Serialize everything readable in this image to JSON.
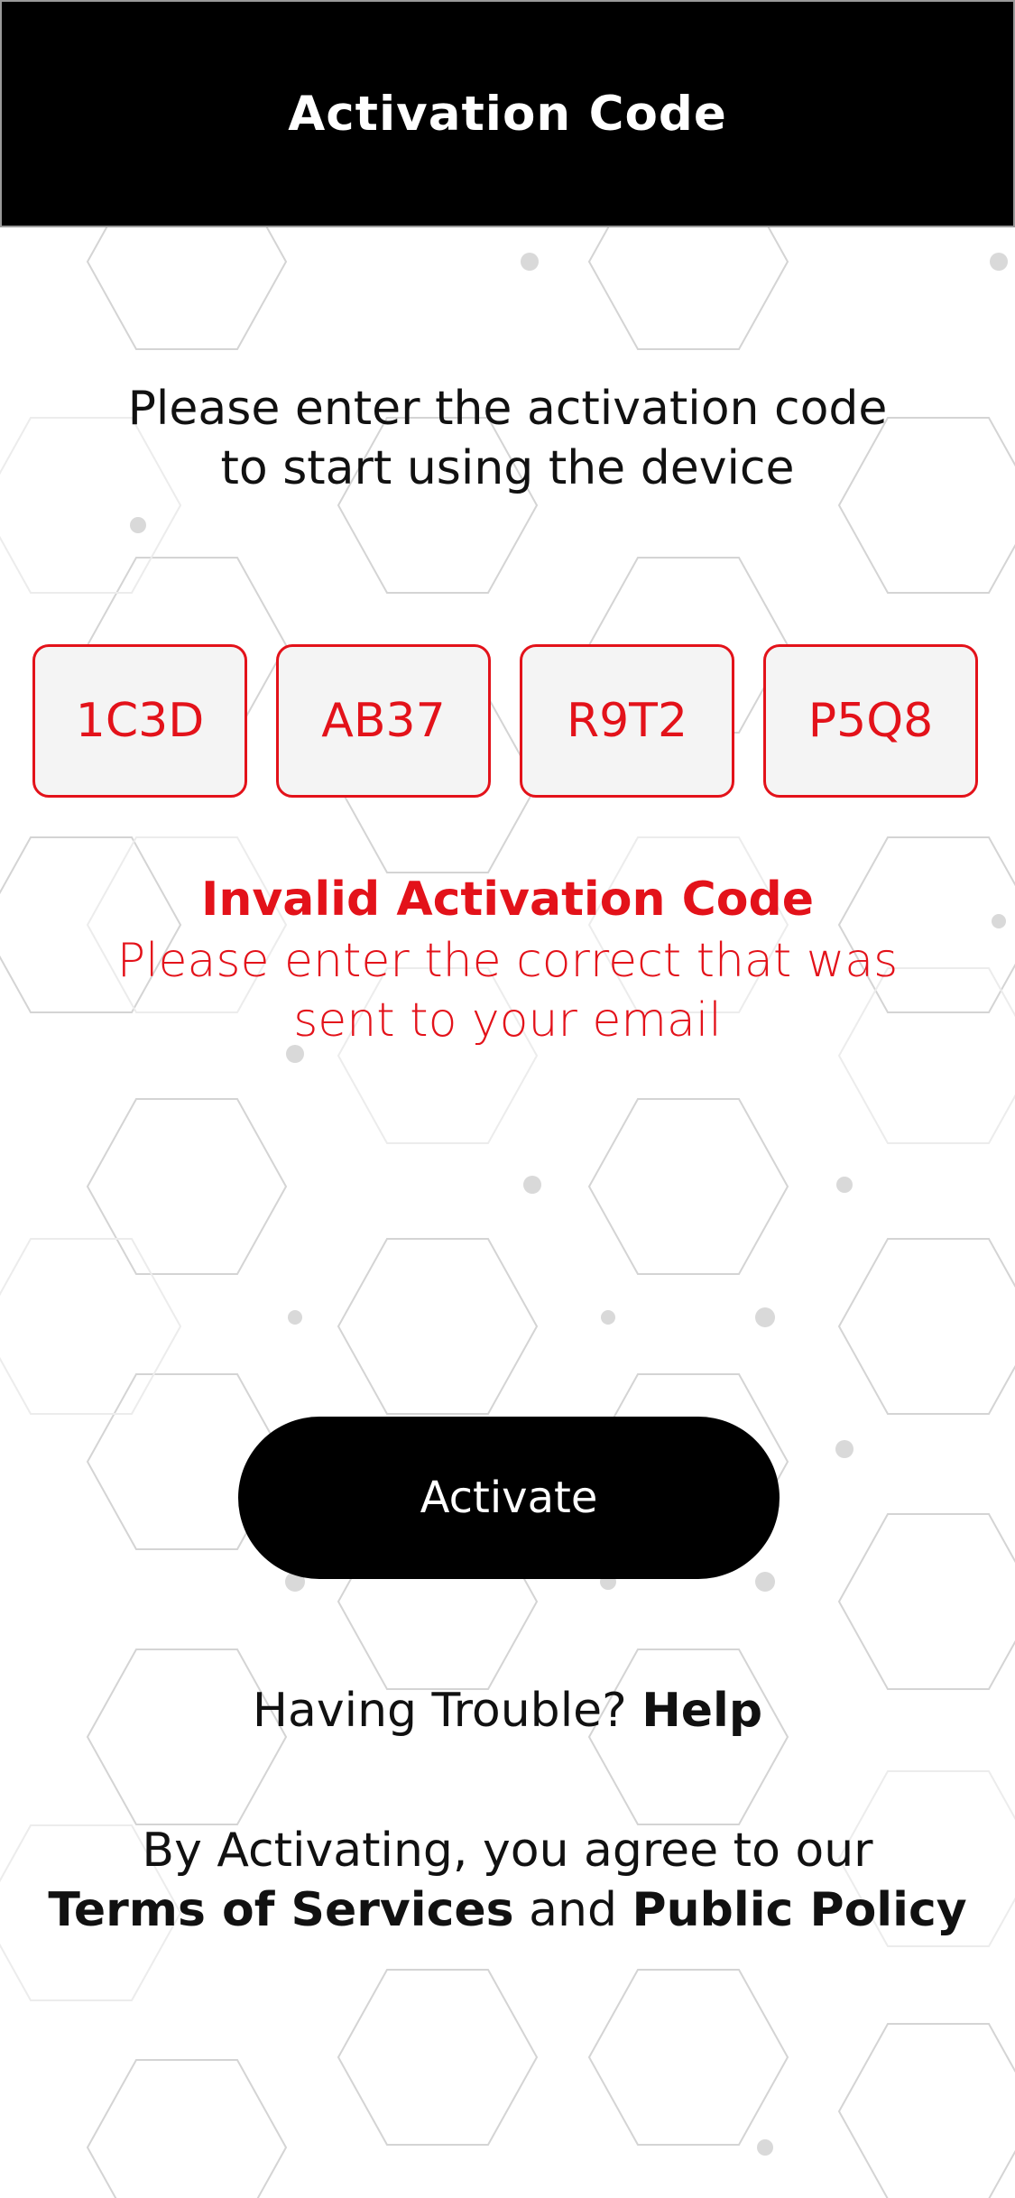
{
  "header": {
    "title": "Activation Code"
  },
  "instructions": {
    "line1": "Please enter the activation code",
    "line2": "to start using the device"
  },
  "code_fields": [
    {
      "value": "1C3D"
    },
    {
      "value": "AB37"
    },
    {
      "value": "R9T2"
    },
    {
      "value": "P5Q8"
    }
  ],
  "error": {
    "title": "Invalid Activation Code",
    "line1": "Please enter the correct that was",
    "line2": "sent to your email"
  },
  "activate_button": {
    "label": "Activate"
  },
  "help": {
    "prefix": "Having Trouble?",
    "link": "Help"
  },
  "terms": {
    "line1": "By Activating, you agree to our",
    "terms_link": "Terms of Services",
    "and": "and",
    "policy_link": "Public Policy"
  },
  "colors": {
    "accent": "#e3121a",
    "header_bg": "#000000",
    "button_bg": "#000000",
    "code_bg": "#f4f4f4"
  }
}
